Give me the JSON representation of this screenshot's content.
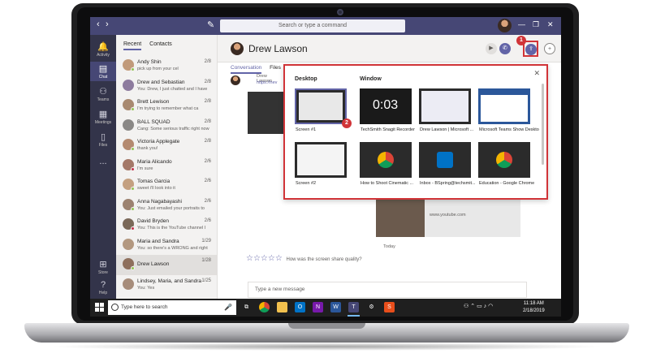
{
  "search": {
    "placeholder": "Search or type a command"
  },
  "rail": [
    {
      "label": "Activity",
      "icon": "bell-icon"
    },
    {
      "label": "Chat",
      "icon": "chat-icon"
    },
    {
      "label": "Teams",
      "icon": "teams-icon"
    },
    {
      "label": "Meetings",
      "icon": "calendar-icon"
    },
    {
      "label": "Files",
      "icon": "file-icon"
    },
    {
      "label": "...",
      "icon": "more-icon"
    },
    {
      "label": "Store",
      "icon": "store-icon"
    },
    {
      "label": "Help",
      "icon": "help-icon"
    }
  ],
  "list": {
    "tabs": [
      "Recent",
      "Contacts"
    ],
    "chats": [
      {
        "name": "Andy Shin",
        "date": "2/8",
        "preview": "pick up from your cel",
        "status": "#92c353"
      },
      {
        "name": "Drew and Sebastian",
        "date": "2/8",
        "preview": "You: Drew, I just chatted and I have",
        "status": ""
      },
      {
        "name": "Brett Lewison",
        "date": "2/8",
        "preview": "I'm trying to remember what ca",
        "status": "#92c353"
      },
      {
        "name": "BALL SQUAD",
        "date": "2/8",
        "preview": "Cang: Some serious traffic right now",
        "status": ""
      },
      {
        "name": "Victoria Applegate",
        "date": "2/8",
        "preview": "thank you!",
        "status": "#92c353"
      },
      {
        "name": "Maria Alicando",
        "date": "2/6",
        "preview": "I'm sure",
        "status": "#c4314b"
      },
      {
        "name": "Tomas Garcia",
        "date": "2/6",
        "preview": "sweet i'll look into it",
        "status": "#92c353"
      },
      {
        "name": "Anna Nagabayashi",
        "date": "2/6",
        "preview": "You: Just emailed your portraits to",
        "status": "#92c353"
      },
      {
        "name": "David Bryden",
        "date": "2/6",
        "preview": "You: This is the YouTube channel I",
        "status": "#c4314b"
      },
      {
        "name": "Maria and Sandra",
        "date": "1/29",
        "preview": "You: so there's a WRONG and right",
        "status": ""
      },
      {
        "name": "Drew Lawson",
        "date": "1/28",
        "preview": "",
        "status": "#92c353"
      },
      {
        "name": "Lindsey, Maria, and Sandra",
        "date": "1/25",
        "preview": "You: Yes",
        "status": ""
      }
    ]
  },
  "main": {
    "name": "Drew Lawson",
    "tabs": [
      "Conversation",
      "Files"
    ],
    "msg_from": "Drew Lawson",
    "msg_link": "https://nev",
    "yt_link": "www.youtube.com",
    "today": "Today",
    "rating_question": "How was the screen share quality?",
    "composer_placeholder": "Type a new message"
  },
  "tray": {
    "desktop_heading": "Desktop",
    "window_heading": "Window",
    "desktop_tiles": [
      "Screen #1",
      "Screen #2"
    ],
    "window_tiles": [
      "TechSmith Snagit Recorder",
      "Drew Lawson | Microsoft ...",
      "Microsoft Teams Show Desktop",
      "How to Shoot Cinematic ...",
      "Inbox - BSpring@techsmit...",
      "Education - Google Chrome"
    ],
    "timer_text": "0:03"
  },
  "callouts": [
    "1",
    "2"
  ],
  "taskbar": {
    "search_placeholder": "Type here to search",
    "time": "11:18 AM",
    "date": "2/18/2019"
  },
  "colors": {
    "accent": "#6264a7",
    "topbar": "#464775",
    "rail": "#33344a",
    "callout": "#d13438"
  }
}
